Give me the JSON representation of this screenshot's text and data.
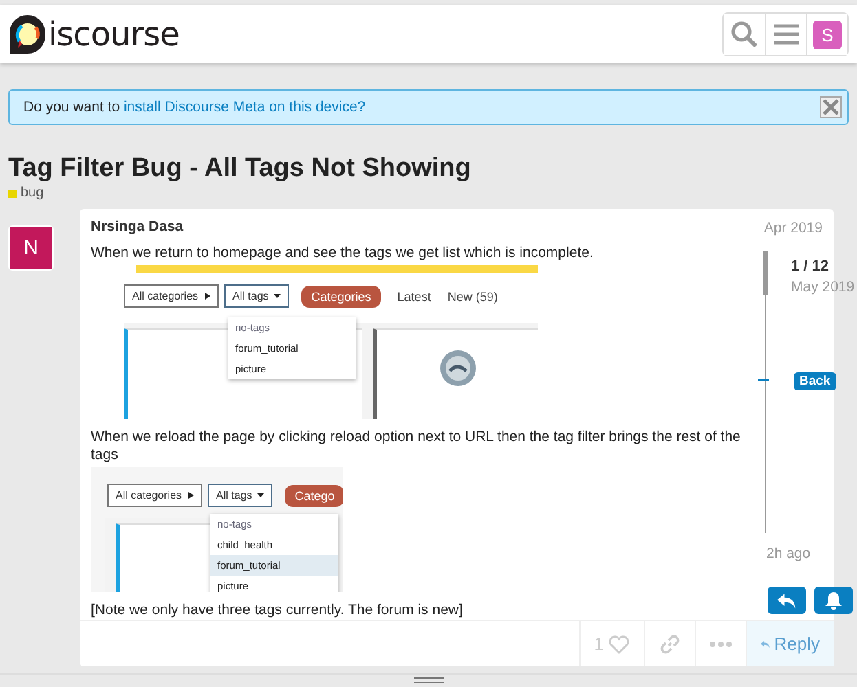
{
  "header": {
    "logo_text": "iscourse",
    "avatar_letter": "S"
  },
  "banner": {
    "text": "Do you want to ",
    "link": "install Discourse Meta on this device?"
  },
  "topic": {
    "title": "Tag Filter Bug - All Tags Not Showing",
    "tags": [
      {
        "label": "bug",
        "color": "#e8d600"
      }
    ]
  },
  "post": {
    "avatar_letter": "N",
    "author": "Nrsinga Dasa",
    "date": "Apr 2019",
    "blocks": [
      {
        "kind": "text",
        "text": "When we return to homepage and see the tags we get list which is incomplete."
      },
      {
        "kind": "screenshot",
        "banner": true,
        "filters": [
          "All categories",
          "All tags"
        ],
        "category_button": "Categories",
        "nav": [
          "Latest",
          "New (59)"
        ],
        "tags": [
          {
            "label": "no-tags",
            "selected": false
          },
          {
            "label": "forum_tutorial",
            "selected": false
          },
          {
            "label": "picture",
            "selected": false
          }
        ]
      },
      {
        "kind": "text",
        "text": "When we reload the page by clicking reload option next to URL then the tag filter brings the rest of the tags"
      },
      {
        "kind": "screenshot",
        "banner": false,
        "filters": [
          "All categories",
          "All tags"
        ],
        "category_button": "Catego",
        "tags": [
          {
            "label": "no-tags",
            "selected": false
          },
          {
            "label": "child_health",
            "selected": false
          },
          {
            "label": "forum_tutorial",
            "selected": true
          },
          {
            "label": "picture",
            "selected": false
          }
        ]
      },
      {
        "kind": "text",
        "text": "[Note we only have three tags currently. The forum is new]"
      }
    ],
    "likes": "1",
    "reply": "Reply"
  },
  "timeline": {
    "position": "1 / 12",
    "start_date": "May 2019",
    "back": "Back",
    "end_date": "2h ago"
  }
}
